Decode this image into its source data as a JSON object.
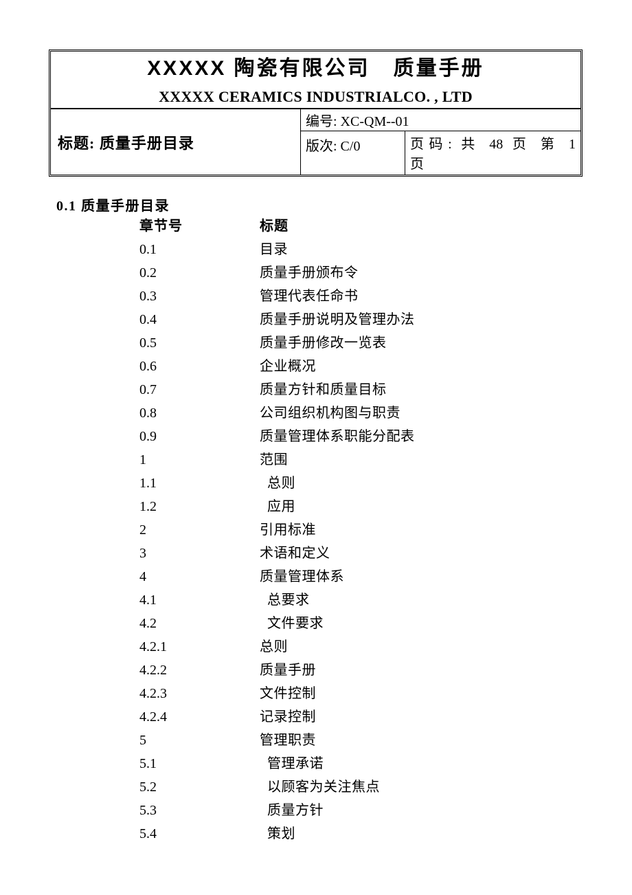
{
  "header": {
    "company_cn": "XXXXX 陶瓷有限公司   质量手册",
    "company_en": "XXXXX CERAMICS INDUSTRIALCO. , LTD",
    "doc_title": "标题: 质量手册目录",
    "doc_number": "编号: XC-QM--01",
    "version": "版次: C/0",
    "page_info_line1": "页码: 共 48 页 第 1",
    "page_info_line2": "页"
  },
  "section": {
    "heading": "0.1 质量手册目录"
  },
  "toc": {
    "col_num_header": "章节号",
    "col_label_header": "标题",
    "rows": [
      {
        "num": "0.1",
        "label": "目录",
        "indent": false
      },
      {
        "num": "0.2",
        "label": "质量手册颁布令",
        "indent": false
      },
      {
        "num": "0.3",
        "label": "管理代表任命书",
        "indent": false
      },
      {
        "num": "0.4",
        "label": "质量手册说明及管理办法",
        "indent": false
      },
      {
        "num": "0.5",
        "label": "质量手册修改一览表",
        "indent": false
      },
      {
        "num": "0.6",
        "label": "企业概况",
        "indent": false
      },
      {
        "num": "0.7",
        "label": "质量方针和质量目标",
        "indent": false
      },
      {
        "num": "0.8",
        "label": "公司组织机构图与职责",
        "indent": false
      },
      {
        "num": "0.9",
        "label": "质量管理体系职能分配表",
        "indent": false
      },
      {
        "num": "1",
        "label": "范围",
        "indent": false
      },
      {
        "num": "1.1",
        "label": "总则",
        "indent": true
      },
      {
        "num": "1.2",
        "label": "应用",
        "indent": true
      },
      {
        "num": "2",
        "label": "引用标准",
        "indent": false
      },
      {
        "num": "3",
        "label": "术语和定义",
        "indent": false
      },
      {
        "num": "4",
        "label": "质量管理体系",
        "indent": false
      },
      {
        "num": "4.1",
        "label": "总要求",
        "indent": true
      },
      {
        "num": "4.2",
        "label": "文件要求",
        "indent": true
      },
      {
        "num": "4.2.1",
        "label": "总则",
        "indent": false
      },
      {
        "num": "4.2.2",
        "label": "质量手册",
        "indent": false
      },
      {
        "num": "4.2.3",
        "label": "文件控制",
        "indent": false
      },
      {
        "num": "4.2.4",
        "label": "记录控制",
        "indent": false
      },
      {
        "num": "5",
        "label": "管理职责",
        "indent": false
      },
      {
        "num": "5.1",
        "label": "管理承诺",
        "indent": true
      },
      {
        "num": "5.2",
        "label": "以顾客为关注焦点",
        "indent": true
      },
      {
        "num": "5.3",
        "label": "质量方针",
        "indent": true
      },
      {
        "num": "5.4",
        "label": "策划",
        "indent": true
      }
    ]
  }
}
